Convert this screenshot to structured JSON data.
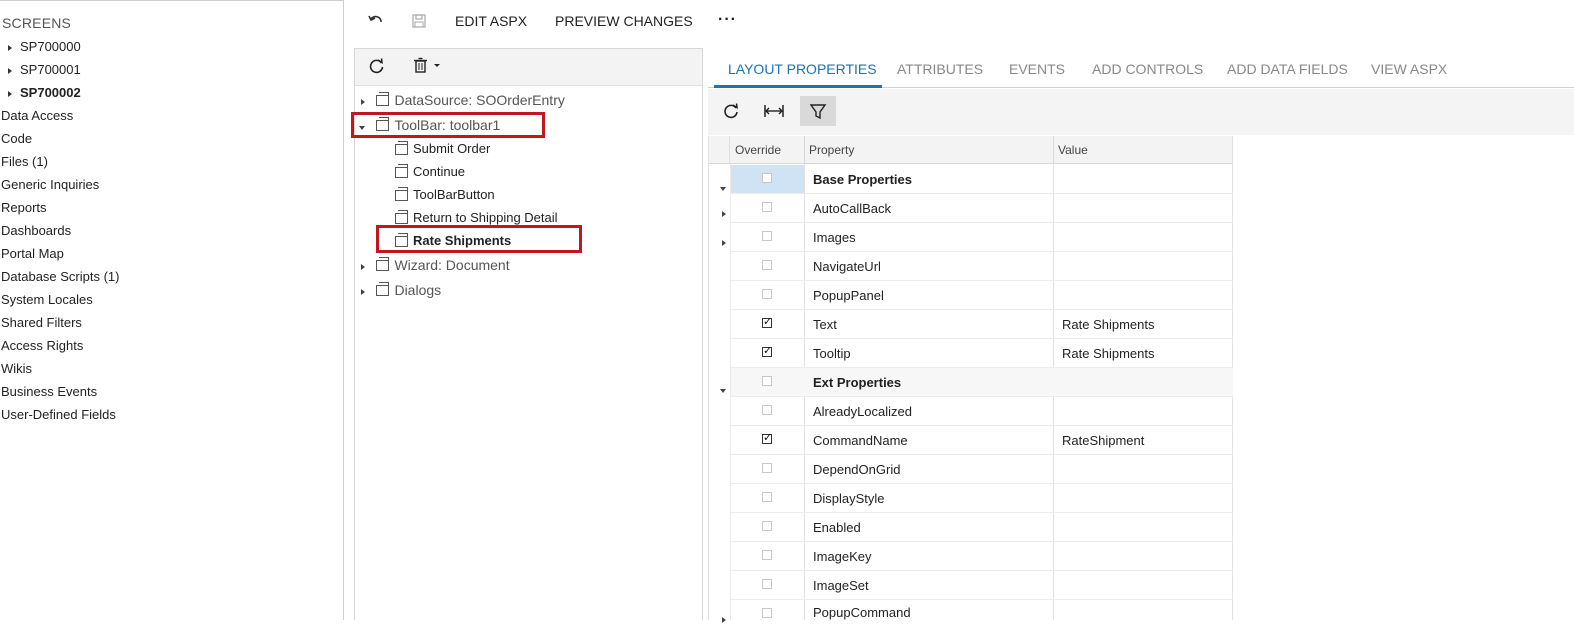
{
  "nav": {
    "title": "SCREENS",
    "screens": [
      "SP700000",
      "SP700001",
      "SP700002"
    ],
    "items": [
      "Data Access",
      "Code",
      "Files (1)",
      "Generic Inquiries",
      "Reports",
      "Dashboards",
      "Portal Map",
      "Database Scripts (1)",
      "System Locales",
      "Shared Filters",
      "Access Rights",
      "Wikis",
      "Business Events",
      "User-Defined Fields"
    ]
  },
  "toolbar": {
    "undo_icon": "undo-icon",
    "save_icon": "save-icon",
    "edit_aspx": "EDIT ASPX",
    "preview_changes": "PREVIEW CHANGES",
    "more": "···"
  },
  "tree": {
    "refresh_icon": "refresh-icon",
    "delete_icon": "trash-icon",
    "nodes": [
      "DataSource: SOOrderEntry",
      "ToolBar: toolbar1",
      "Wizard: Document",
      "Dialogs"
    ],
    "toolbar_children": [
      "Submit Order",
      "Continue",
      "ToolBarButton",
      "Return to Shipping Detail",
      "Rate Shipments"
    ]
  },
  "tabs": [
    "LAYOUT PROPERTIES",
    "ATTRIBUTES",
    "EVENTS",
    "ADD CONTROLS",
    "ADD DATA FIELDS",
    "VIEW ASPX"
  ],
  "grid": {
    "headers": {
      "override": "Override",
      "property": "Property",
      "value": "Value"
    },
    "rows": [
      {
        "property": "Base Properties",
        "value": "",
        "group": true,
        "checked": false
      },
      {
        "property": "AutoCallBack",
        "value": "",
        "checked": false
      },
      {
        "property": "Images",
        "value": "",
        "checked": false
      },
      {
        "property": "NavigateUrl",
        "value": "",
        "checked": false
      },
      {
        "property": "PopupPanel",
        "value": "",
        "checked": false
      },
      {
        "property": "Text",
        "value": "Rate Shipments",
        "checked": true
      },
      {
        "property": "Tooltip",
        "value": "Rate Shipments",
        "checked": true
      },
      {
        "property": "Ext Properties",
        "value": "",
        "group": true,
        "checked": false
      },
      {
        "property": "AlreadyLocalized",
        "value": "",
        "checked": false
      },
      {
        "property": "CommandName",
        "value": "RateShipment",
        "checked": true
      },
      {
        "property": "DependOnGrid",
        "value": "",
        "checked": false
      },
      {
        "property": "DisplayStyle",
        "value": "",
        "checked": false
      },
      {
        "property": "Enabled",
        "value": "",
        "checked": false
      },
      {
        "property": "ImageKey",
        "value": "",
        "checked": false
      },
      {
        "property": "ImageSet",
        "value": "",
        "checked": false
      },
      {
        "property": "PopupCommand",
        "value": "",
        "checked": false
      }
    ]
  },
  "colors": {
    "accent": "#1a73b8",
    "highlight": "#c4161c"
  }
}
